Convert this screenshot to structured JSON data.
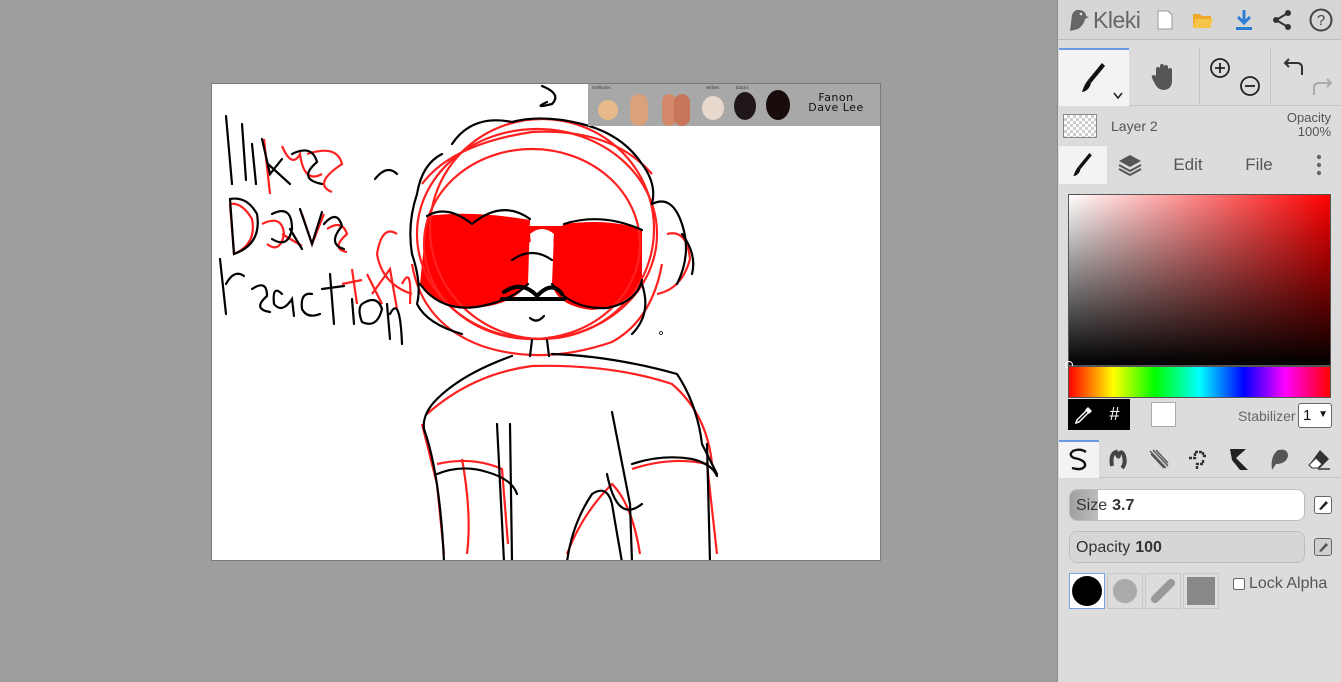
{
  "app": {
    "logo_text": "Kleki",
    "topbar_icons": [
      "new-file-icon",
      "open-folder-icon",
      "download-icon",
      "share-icon",
      "help-icon"
    ]
  },
  "canvas": {
    "palette_labels": [
      "midtones",
      "",
      "",
      "",
      "whites",
      "blacks",
      ""
    ],
    "palette_colors": [
      "#e8b98a",
      "#d9a27a",
      "#c8765a",
      "#e8d9cf",
      "#201818",
      "#180c0c"
    ],
    "palette_title_line1": "Fanon",
    "palette_title_line2": "Dave Lee"
  },
  "toolbar": {
    "tools": [
      "brush-tool",
      "hand-tool",
      "zoom-tool",
      "undo-redo-tool"
    ],
    "active": "brush-tool"
  },
  "layer": {
    "name": "Layer 2",
    "opacity_label": "Opacity",
    "opacity_value": "100%"
  },
  "tabs": {
    "edit": "Edit",
    "file": "File"
  },
  "color": {
    "hue": "#ff0000",
    "current": "#ffffff",
    "hex_symbol": "#"
  },
  "stabilizer": {
    "label": "Stabilizer",
    "value": "1"
  },
  "brush": {
    "types": [
      "pen-brush",
      "blend-brush",
      "sketchy-brush",
      "pixel-brush",
      "chemy-brush",
      "smudge-brush",
      "eraser-brush"
    ],
    "size_label": "Size",
    "size_value": "3.7",
    "size_fraction": 0.12,
    "opacity_label": "Opacity",
    "opacity_value": "100",
    "opacity_fraction": 1.0,
    "tips": [
      "round-tip",
      "soft-tip",
      "line-tip",
      "square-tip"
    ],
    "lock_alpha_label": "Lock Alpha",
    "lock_alpha_checked": false
  },
  "accent_color": "#6c9be5"
}
